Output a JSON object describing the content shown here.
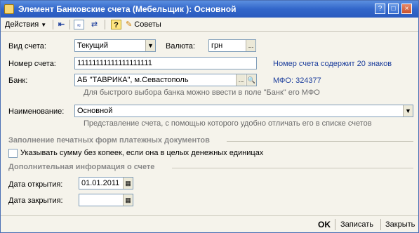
{
  "window": {
    "title": "Элемент Банковские счета (Мебельщик ): Основной"
  },
  "titlebar_buttons": {
    "help": "?",
    "maximize": "□",
    "close": "×"
  },
  "toolbar": {
    "actions_label": "Действия",
    "tips_label": "Советы",
    "icons": [
      "back-arrow-icon",
      "form-icon",
      "sync-icon",
      "help-icon",
      "tips-icon"
    ]
  },
  "form": {
    "account_type": {
      "label": "Вид счета:",
      "value": "Текущий"
    },
    "currency": {
      "label": "Валюта:",
      "value": "грн"
    },
    "account_number": {
      "label": "Номер счета:",
      "value": "11111111111111111111",
      "note": "Номер счета содержит 20 знаков"
    },
    "bank": {
      "label": "Банк:",
      "value": "АБ \"ТАВРИКА\", м.Севастополь",
      "mfo": "МФО: 324377",
      "hint": "Для быстрого выбора банка можно ввести в поле \"Банк\" его МФО"
    },
    "name": {
      "label": "Наименование:",
      "value": "Основной",
      "hint": "Представление счета, с помощью которого удобно отличать его в списке счетов"
    }
  },
  "print_section": {
    "title": "Заполнение печатных форм платежных документов",
    "checkbox_label": "Указывать сумму без копеек, если она в целых денежных единицах",
    "checked": false
  },
  "extra_section": {
    "title": "Дополнительная информация о счете",
    "open_date": {
      "label": "Дата открытия:",
      "value": "01.01.2011"
    },
    "close_date": {
      "label": "Дата закрытия:",
      "value": " .  ."
    }
  },
  "footer": {
    "ok": "OK",
    "save": "Записать",
    "close": "Закрыть"
  }
}
